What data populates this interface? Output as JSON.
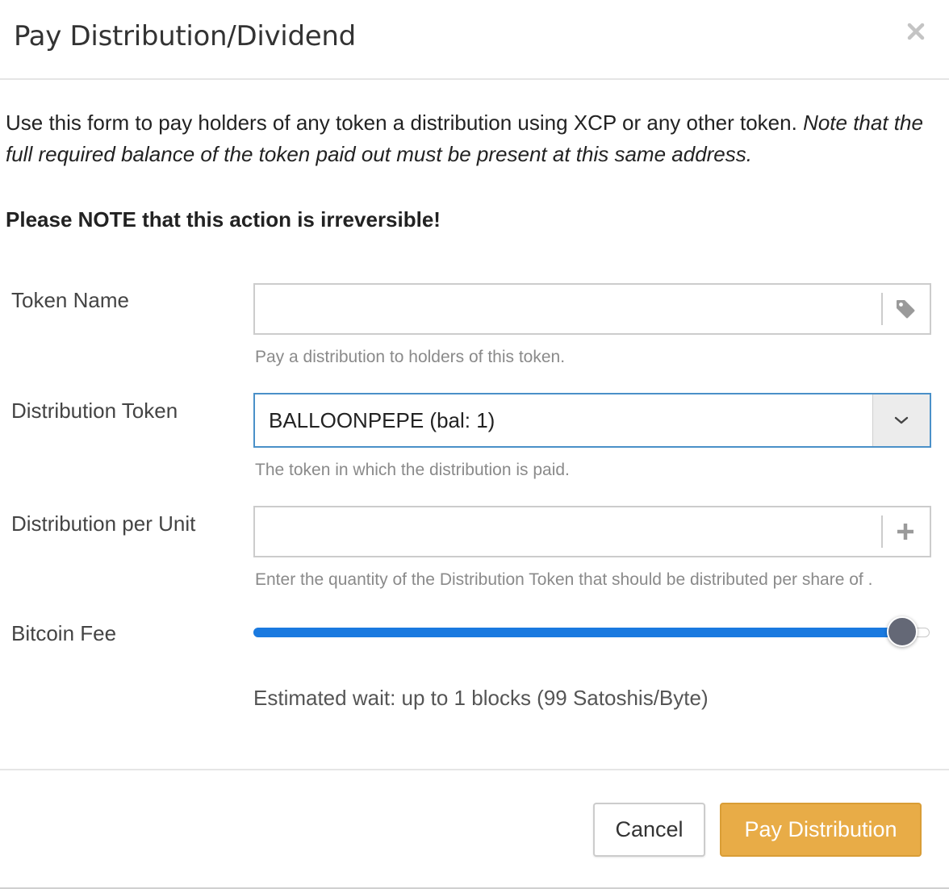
{
  "modal": {
    "title": "Pay Distribution/Dividend",
    "close_icon": "close-icon"
  },
  "intro": {
    "text": "Use this form to pay holders of any token a distribution using XCP or any other token. ",
    "note": "Note that the full required balance of the token paid out must be present at this same address."
  },
  "warning": "Please NOTE that this action is irreversible!",
  "form": {
    "token_name": {
      "label": "Token Name",
      "value": "",
      "placeholder": "",
      "icon": "tag-icon",
      "help": "Pay a distribution to holders of this token."
    },
    "distribution_token": {
      "label": "Distribution Token",
      "selected": "BALLOONPEPE (bal: 1)",
      "icon": "chevron-down-icon",
      "help": "The token in which the distribution is paid."
    },
    "distribution_per_unit": {
      "label": "Distribution per Unit",
      "value": "",
      "placeholder": "",
      "icon": "plus-icon",
      "help": "Enter the quantity of the Distribution Token that should be distributed per share of ."
    },
    "bitcoin_fee": {
      "label": "Bitcoin Fee",
      "level": 0.96,
      "estimate": "Estimated wait: up to 1 blocks (99 Satoshis/Byte)"
    }
  },
  "footer": {
    "cancel_label": "Cancel",
    "submit_label": "Pay Distribution"
  },
  "colors": {
    "primary": "#e8ac47",
    "slider_fill": "#1a7ae0",
    "select_focus": "#4a90c8",
    "help_text": "#8a8a8a"
  }
}
